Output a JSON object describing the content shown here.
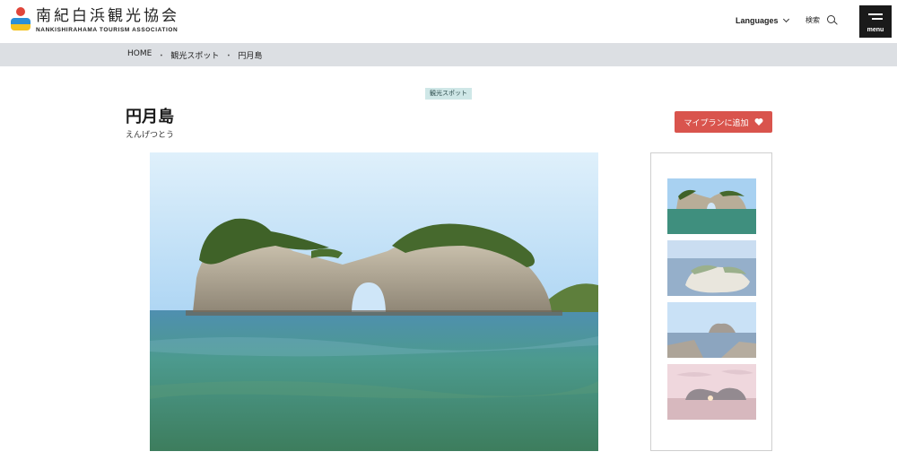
{
  "header": {
    "logo_jp": "南紀白浜観光協会",
    "logo_en": "NANKISHIRAHAMA TOURISM ASSOCIATION",
    "languages_label": "Languages",
    "search_label": "検索",
    "menu_label": "menu"
  },
  "breadcrumb": {
    "items": [
      "HOME",
      "観光スポット",
      "円月島"
    ],
    "separator": "・"
  },
  "spot": {
    "category": "観光スポット",
    "title": "円月島",
    "reading": "えんげつとう",
    "myplan_label": "マイプランに追加"
  },
  "colors": {
    "myplan": "#d9544d",
    "tag_bg": "#cfe7e7",
    "breadcrumb_bg": "#dcdfe3"
  },
  "icons": [
    "chevron-down-icon",
    "search-icon",
    "menu-icon",
    "heart-icon"
  ]
}
